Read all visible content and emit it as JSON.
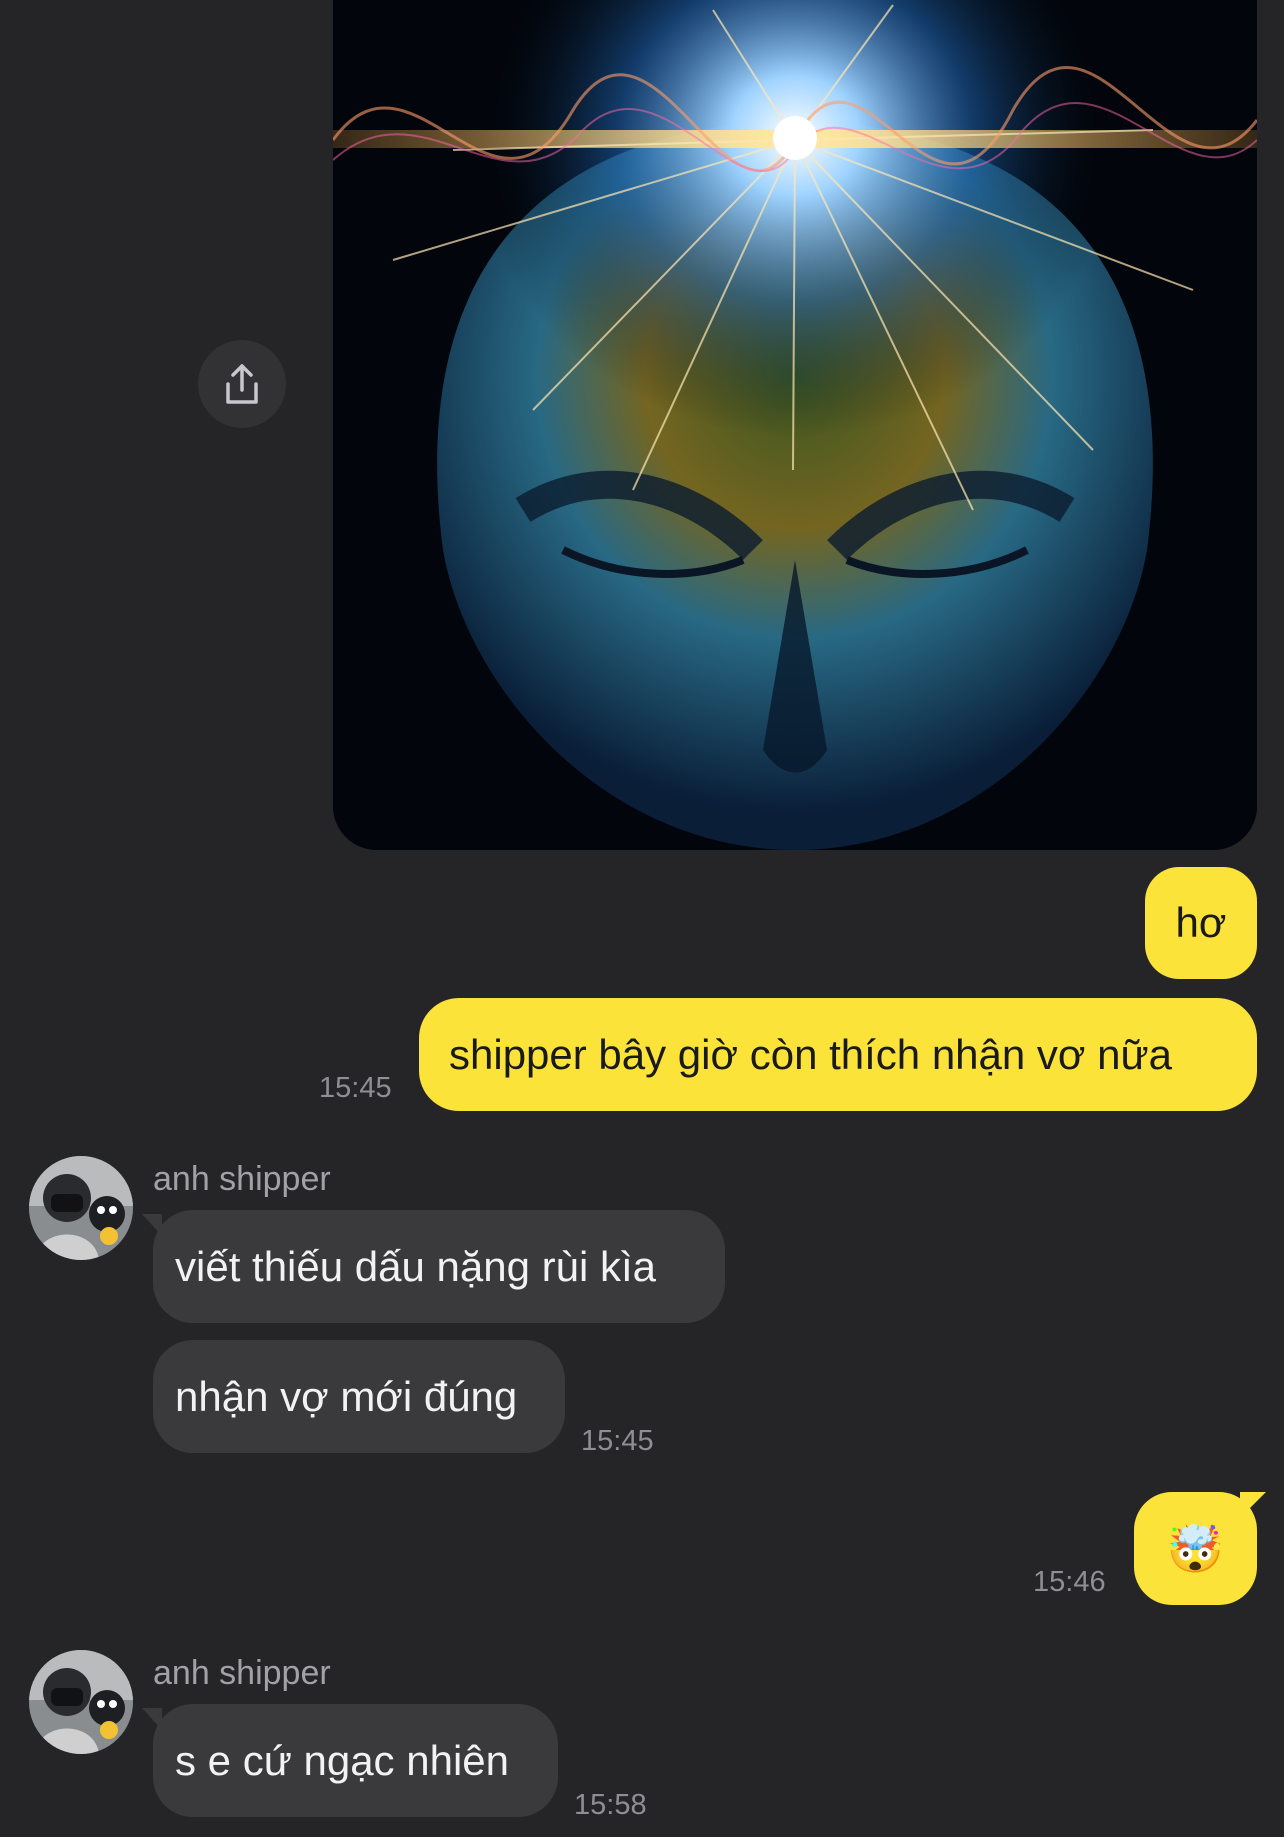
{
  "messages": {
    "m1": {
      "text": "hơ"
    },
    "m2": {
      "text": "shipper bây giờ còn thích nhận vơ nữa",
      "time": "15:45"
    },
    "g1": {
      "sender": "anh shipper",
      "line1": "viết thiếu dấu nặng rùi kìa",
      "line2": "nhận vợ mới đúng",
      "time": "15:45"
    },
    "m3": {
      "emoji": "🤯",
      "time": "15:46"
    },
    "g2": {
      "sender": "anh shipper",
      "line1": "s e cứ ngạc nhiên",
      "time": "15:58"
    }
  },
  "icons": {
    "share": "share-icon",
    "avatar": "avatar"
  },
  "colors": {
    "background": "#252527",
    "outgoing_bubble": "#fbe33a",
    "incoming_bubble": "#3a3a3d",
    "timestamp": "#8e8e93"
  }
}
